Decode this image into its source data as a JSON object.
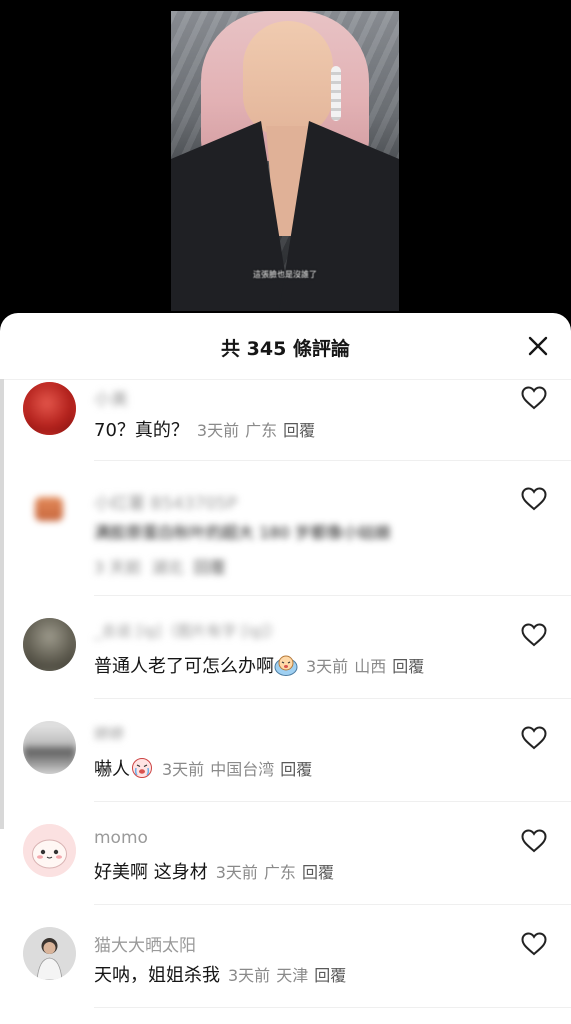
{
  "video": {
    "subtitle": "這張臉也是沒誰了"
  },
  "header": {
    "title": "共 345 條評論"
  },
  "comments": [
    {
      "username": "小美",
      "text": "70？真的？",
      "time": "3天前",
      "location": "广东",
      "reply": "回覆",
      "blurred_name": true
    },
    {
      "username": "小红薯 B543705P",
      "text": "满胶原蛋白秋叶的超大 180 岁都像小姑娘",
      "time": "3 天前",
      "location": "湖北",
      "reply": "回覆",
      "blurred_name": true,
      "blurred_text": true
    },
    {
      "username": "_去说 [ig]（图片有字 [ig]）",
      "text": "普通人老了可怎么办啊",
      "time": "3天前",
      "location": "山西",
      "reply": "回覆",
      "blurred_name": true
    },
    {
      "username": "婷婷",
      "text": "嚇人",
      "time": "3天前",
      "location": "中国台湾",
      "reply": "回覆",
      "blurred_name": true
    },
    {
      "username": "momo",
      "text": "好美啊 这身材",
      "time": "3天前",
      "location": "广东",
      "reply": "回覆",
      "blurred_name": false
    },
    {
      "username": "猫大大晒太阳",
      "text": "天呐，姐姐杀我",
      "time": "3天前",
      "location": "天津",
      "reply": "回覆",
      "blurred_name": false
    }
  ],
  "icons": {
    "close": "close-icon",
    "like": "heart-outline-icon",
    "emoji_cry": "crying-face-emoji"
  },
  "colors": {
    "text_primary": "#161616",
    "text_secondary": "#8a8a8a",
    "sheet_bg": "#ffffff",
    "video_bg": "#000000"
  }
}
